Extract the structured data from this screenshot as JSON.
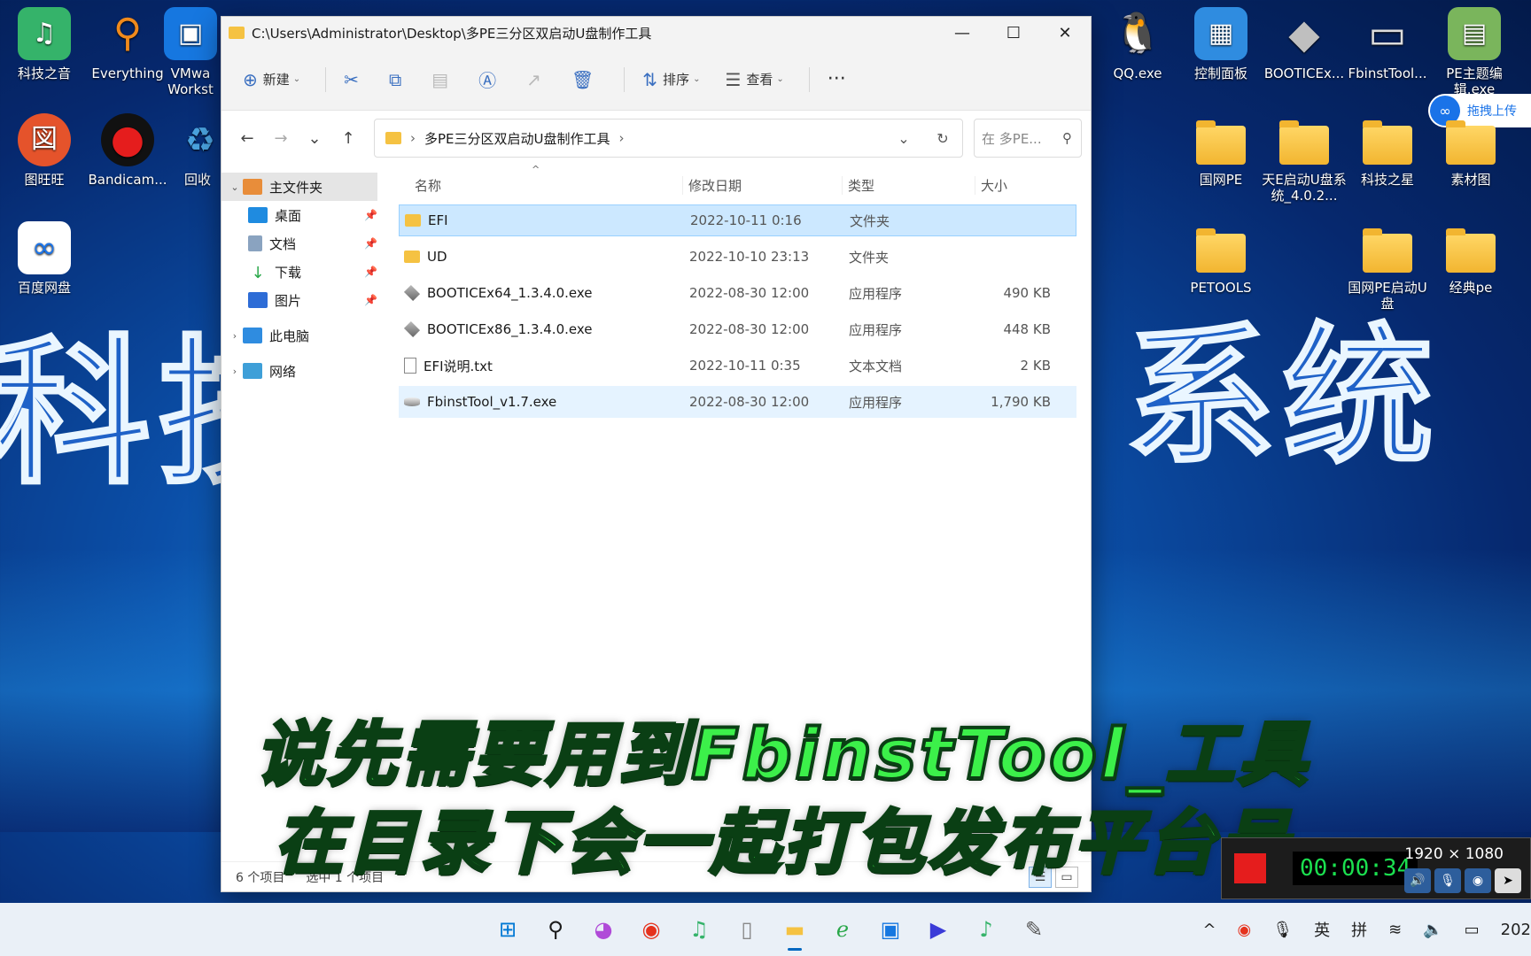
{
  "desktop": {
    "left_icons": [
      {
        "label": "科技之音",
        "glyph": "♫",
        "color": "#35b36a"
      },
      {
        "label": "Everything",
        "glyph": "⚲",
        "color": "#f08a1c"
      },
      {
        "label": "VMwa Workst",
        "glyph": "▣",
        "color": "#1677e0"
      },
      {
        "label": "图旺旺",
        "glyph": "図",
        "color": "#e5532b"
      },
      {
        "label": "Bandicam...",
        "glyph": "●",
        "color": "#111"
      },
      {
        "label": "回收",
        "glyph": "♻",
        "color": "#4aa3df"
      },
      {
        "label": "百度网盘",
        "glyph": "∞",
        "color": "#ffffff"
      }
    ],
    "right_icons": [
      {
        "label": "QQ.exe",
        "glyph": "🐧"
      },
      {
        "label": "控制面板",
        "glyph": "▦"
      },
      {
        "label": "BOOTICEx...",
        "glyph": "◆"
      },
      {
        "label": "FbinstTool...",
        "glyph": "▭"
      },
      {
        "label": "PE主题编辑.exe",
        "glyph": "▤"
      }
    ],
    "folders": [
      "国网PE",
      "天E启动U盘系统_4.0.2...",
      "科技之星",
      "素材图",
      "PETOOLS",
      "国网PE启动U盘",
      "经典pe"
    ],
    "wallpaper_left": "科技",
    "wallpaper_right": "系统",
    "upload_label": "拖拽上传"
  },
  "window": {
    "title": "C:\\Users\\Administrator\\Desktop\\多PE三分区双启动U盘制作工具",
    "controls": {
      "minimize": "—",
      "maximize": "☐",
      "close": "✕"
    },
    "toolbar": {
      "new_label": "新建",
      "sort_label": "排序",
      "view_label": "查看",
      "more_label": "···"
    },
    "address": {
      "crumb": "多PE三分区双启动U盘制作工具",
      "search_placeholder": "在 多PE..."
    },
    "sidebar": {
      "home": "主文件夹",
      "quick": [
        {
          "label": "桌面",
          "color": "#1f8be0"
        },
        {
          "label": "文档",
          "color": "#8aa3c0"
        },
        {
          "label": "下载",
          "color": "#2aa84a"
        },
        {
          "label": "图片",
          "color": "#2d6cd6"
        }
      ],
      "this_pc": "此电脑",
      "network": "网络"
    },
    "columns": {
      "name": "名称",
      "date": "修改日期",
      "type": "类型",
      "size": "大小"
    },
    "files": [
      {
        "name": "EFI",
        "date": "2022-10-11 0:16",
        "type": "文件夹",
        "size": "",
        "icon": "folder"
      },
      {
        "name": "UD",
        "date": "2022-10-10 23:13",
        "type": "文件夹",
        "size": "",
        "icon": "folder"
      },
      {
        "name": "BOOTICEx64_1.3.4.0.exe",
        "date": "2022-08-30 12:00",
        "type": "应用程序",
        "size": "490 KB",
        "icon": "exe"
      },
      {
        "name": "BOOTICEx86_1.3.4.0.exe",
        "date": "2022-08-30 12:00",
        "type": "应用程序",
        "size": "448 KB",
        "icon": "exe"
      },
      {
        "name": "EFI说明.txt",
        "date": "2022-10-11 0:35",
        "type": "文本文档",
        "size": "2 KB",
        "icon": "txt"
      },
      {
        "name": "FbinstTool_v1.7.exe",
        "date": "2022-08-30 12:00",
        "type": "应用程序",
        "size": "1,790 KB",
        "icon": "disk"
      }
    ],
    "status": {
      "count": "6 个项目",
      "selected": "选中 1 个项目"
    }
  },
  "subtitle": {
    "line1": "说先需要用到FbinstTool_工具",
    "line2": "在目录下会一起打包发布平台号"
  },
  "recorder": {
    "time": "00:00:34",
    "resolution": "1920 × 1080"
  },
  "taskbar": {
    "tray": {
      "ime_lang": "英",
      "ime_mode": "拼",
      "clock_partial": "202"
    }
  },
  "colors": {
    "selection": "#cce8ff",
    "subtitle": "#3cf04a",
    "accent": "#0067c0"
  }
}
